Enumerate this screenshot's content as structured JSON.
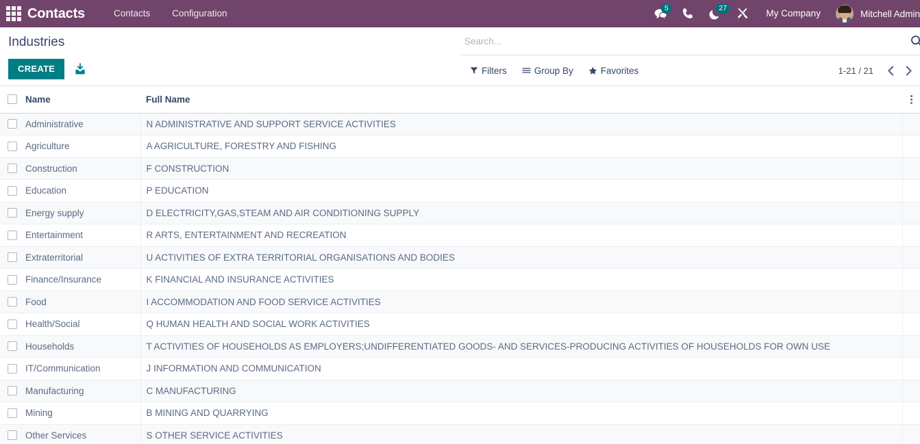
{
  "navbar": {
    "apps_icon": "apps-grid-icon",
    "brand": "Contacts",
    "menus": [
      {
        "label": "Contacts"
      },
      {
        "label": "Configuration"
      }
    ],
    "icons": [
      {
        "name": "messages-icon",
        "badge": "5"
      },
      {
        "name": "phone-icon",
        "badge": ""
      },
      {
        "name": "activities-icon",
        "badge": "27"
      },
      {
        "name": "developer-tools-icon",
        "badge": ""
      }
    ],
    "company": "My Company",
    "user_name": "Mitchell Admin",
    "avatar": "user-avatar"
  },
  "control_panel": {
    "breadcrumb": "Industries",
    "create_label": "CREATE",
    "import_icon": "import-icon",
    "search": {
      "value": "",
      "placeholder": "Search...",
      "icon": "search-icon"
    },
    "filter_buttons": [
      {
        "name": "filters",
        "label": "Filters",
        "icon": "filter-icon"
      },
      {
        "name": "group-by",
        "label": "Group By",
        "icon": "list-icon"
      },
      {
        "name": "favorites",
        "label": "Favorites",
        "icon": "star-icon"
      }
    ],
    "pager": {
      "value": "1-21 / 21",
      "previous_icon": "chevron-left-icon",
      "next_icon": "chevron-right-icon"
    }
  },
  "list": {
    "columns": [
      "Name",
      "Full Name"
    ],
    "optional_columns_icon": "vertical-dots-icon",
    "rows": [
      {
        "name": "Administrative",
        "full_name": "N ADMINISTRATIVE AND SUPPORT SERVICE ACTIVITIES"
      },
      {
        "name": "Agriculture",
        "full_name": "A AGRICULTURE, FORESTRY AND FISHING"
      },
      {
        "name": "Construction",
        "full_name": "F CONSTRUCTION"
      },
      {
        "name": "Education",
        "full_name": "P EDUCATION"
      },
      {
        "name": "Energy supply",
        "full_name": "D ELECTRICITY,GAS,STEAM AND AIR CONDITIONING SUPPLY"
      },
      {
        "name": "Entertainment",
        "full_name": "R ARTS, ENTERTAINMENT AND RECREATION"
      },
      {
        "name": "Extraterritorial",
        "full_name": "U ACTIVITIES OF EXTRA TERRITORIAL ORGANISATIONS AND BODIES"
      },
      {
        "name": "Finance/Insurance",
        "full_name": "K FINANCIAL AND INSURANCE ACTIVITIES"
      },
      {
        "name": "Food",
        "full_name": "I ACCOMMODATION AND FOOD SERVICE ACTIVITIES"
      },
      {
        "name": "Health/Social",
        "full_name": "Q HUMAN HEALTH AND SOCIAL WORK ACTIVITIES"
      },
      {
        "name": "Households",
        "full_name": "T ACTIVITIES OF HOUSEHOLDS AS EMPLOYERS;UNDIFFERENTIATED GOODS- AND SERVICES-PRODUCING ACTIVITIES OF HOUSEHOLDS FOR OWN USE"
      },
      {
        "name": "IT/Communication",
        "full_name": "J INFORMATION AND COMMUNICATION"
      },
      {
        "name": "Manufacturing",
        "full_name": "C MANUFACTURING"
      },
      {
        "name": "Mining",
        "full_name": "B MINING AND QUARRYING"
      },
      {
        "name": "Other Services",
        "full_name": "S OTHER SERVICE ACTIVITIES"
      }
    ]
  },
  "colors": {
    "navbar_bg": "#71446b",
    "accent_teal": "#017e84",
    "badge_teal": "#00717b",
    "text_blue_grey": "#5b6a86",
    "header_text": "#374767"
  }
}
